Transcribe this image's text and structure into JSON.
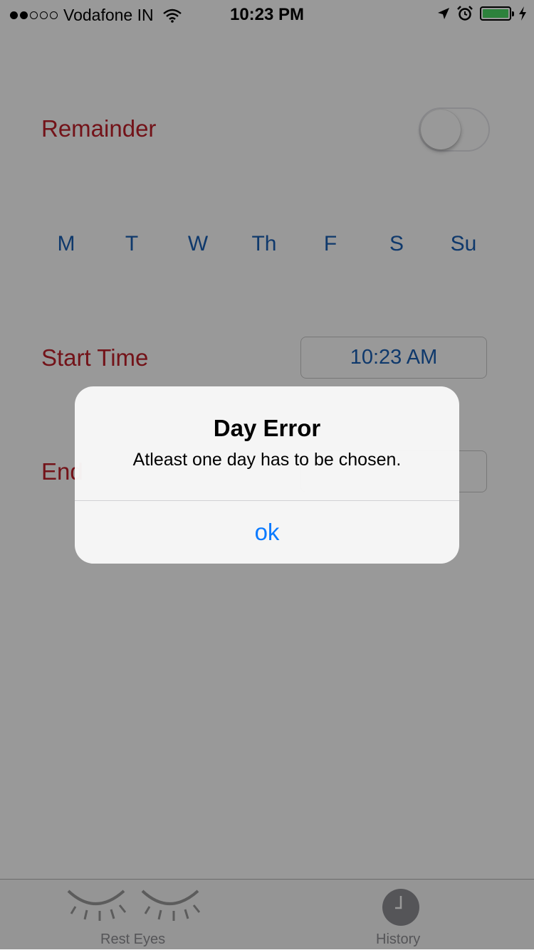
{
  "status_bar": {
    "carrier": "Vodafone IN",
    "time": "10:23 PM",
    "signal_bars_filled": 2,
    "signal_bars_total": 5,
    "battery_level": 1.0,
    "battery_color": "#4cd964",
    "icons": [
      "wifi-icon",
      "location-arrow-icon",
      "alarm-icon",
      "battery-icon",
      "charging-bolt-icon"
    ]
  },
  "form": {
    "reminder_label": "Remainder",
    "reminder_enabled": false,
    "days": [
      "M",
      "T",
      "W",
      "Th",
      "F",
      "S",
      "Su"
    ],
    "start_time_label": "Start Time",
    "start_time_value": "10:23 AM",
    "end_time_label_visible": "End"
  },
  "tab_bar": {
    "tabs": [
      {
        "label": "Rest Eyes",
        "icon": "closed-eyes-icon"
      },
      {
        "label": "History",
        "icon": "clock-icon"
      }
    ]
  },
  "alert": {
    "title": "Day Error",
    "message": "Atleast one day has to be chosen.",
    "button_label": "ok"
  },
  "colors": {
    "label_red": "#c0202a",
    "day_blue": "#1a5fb4",
    "ios_blue": "#0a7aff"
  }
}
